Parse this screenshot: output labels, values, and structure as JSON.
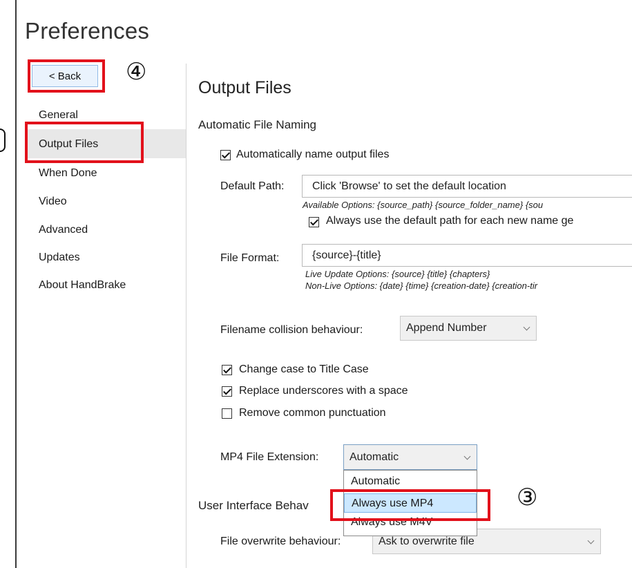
{
  "window": {
    "title": "Preferences"
  },
  "back_button": {
    "label": "< Back"
  },
  "sidebar": {
    "items": [
      {
        "label": "General"
      },
      {
        "label": "Output Files"
      },
      {
        "label": "When Done"
      },
      {
        "label": "Video"
      },
      {
        "label": "Advanced"
      },
      {
        "label": "Updates"
      },
      {
        "label": "About HandBrake"
      }
    ],
    "selected": "Output Files"
  },
  "main": {
    "title": "Output Files",
    "section_auto": "Automatic File Naming",
    "auto_name": {
      "label": "Automatically name output files",
      "checked": true
    },
    "default_path": {
      "label": "Default Path:",
      "value": "Click 'Browse' to set the default location",
      "hint": "Available Options: {source_path} {source_folder_name} {sou",
      "always_default": {
        "label": "Always use the default path for each new name ge",
        "checked": true
      }
    },
    "file_format": {
      "label": "File Format:",
      "value": "{source}-{title}",
      "hint_live": "Live Update Options: {source} {title} {chapters}",
      "hint_nonlive": "Non-Live Options: {date} {time} {creation-date} {creation-tir"
    },
    "collision": {
      "label": "Filename collision behaviour:",
      "value": "Append Number"
    },
    "title_case": {
      "label": "Change case to Title Case",
      "checked": true
    },
    "underscores": {
      "label": "Replace underscores with a space",
      "checked": true
    },
    "punctuation": {
      "label": "Remove common punctuation",
      "checked": false
    },
    "mp4_ext": {
      "label": "MP4 File Extension:",
      "value": "Automatic",
      "options": [
        "Automatic",
        "Always use MP4",
        "Always use M4V"
      ],
      "highlighted": "Always use MP4"
    },
    "section_ui": "User Interface Behav",
    "overwrite": {
      "label": "File overwrite behaviour:",
      "value": "Ask to overwrite file"
    }
  },
  "annotations": {
    "step3": "③",
    "step4": "④"
  },
  "colors": {
    "annotation_red": "#e2111b",
    "selection_blue": "#cce8ff",
    "nav_selected": "#e8e8e8"
  }
}
